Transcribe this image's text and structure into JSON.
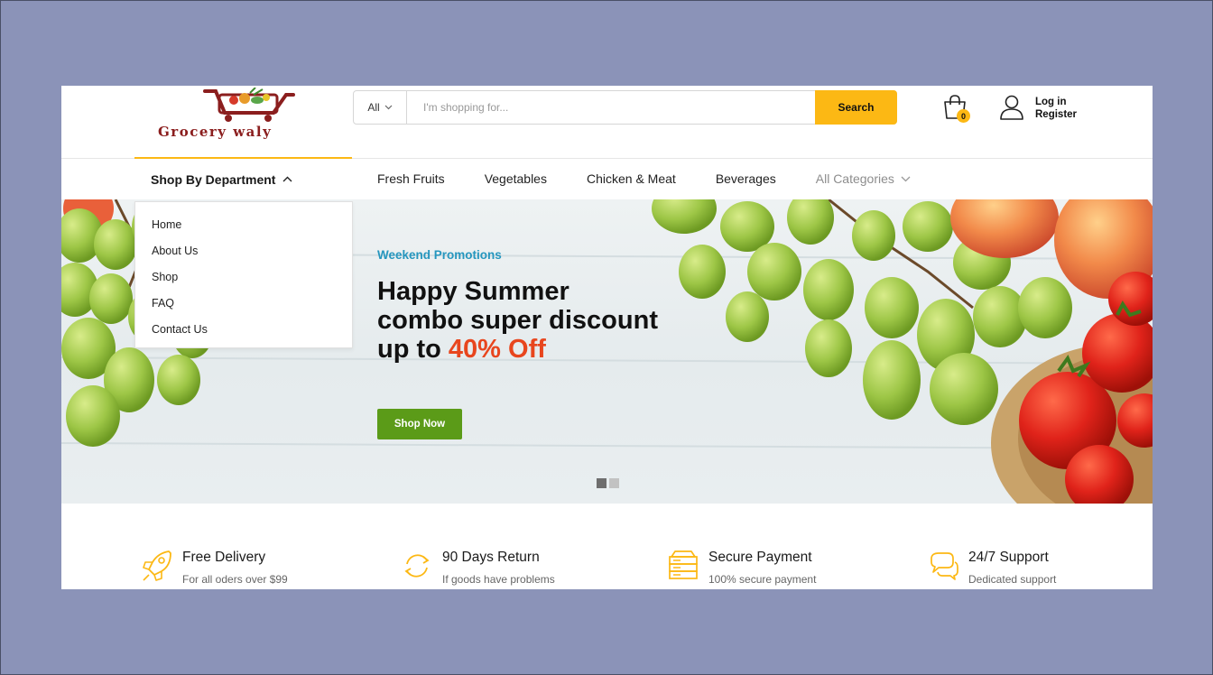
{
  "brand": {
    "name": "Grocery waly",
    "accent_color": "#fcb814",
    "logo_color": "#8b1e1e"
  },
  "search": {
    "category": "All",
    "placeholder": "I'm shopping for...",
    "button": "Search"
  },
  "cart": {
    "count": "0",
    "icon": "shopping-bag-icon"
  },
  "account": {
    "login": "Log in",
    "register": "Register",
    "icon": "user-icon"
  },
  "nav": {
    "department": "Shop By Department",
    "links": [
      "Fresh Fruits",
      "Vegetables",
      "Chicken & Meat",
      "Beverages"
    ],
    "all_categories": "All Categories"
  },
  "dropdown": {
    "items": [
      "Home",
      "About Us",
      "Shop",
      "FAQ",
      "Contact Us"
    ]
  },
  "hero": {
    "tag": "Weekend Promotions",
    "line1": "Happy Summer",
    "line2": "combo super discount",
    "line3_prefix": "up to",
    "line3_accent": "40% Off",
    "cta": "Shop Now",
    "cta_color": "#5b9b18",
    "tag_color": "#2596be",
    "accent_color": "#e8461e",
    "slides": 2,
    "active_slide": 1
  },
  "features": [
    {
      "title": "Free Delivery",
      "subtitle": "For all oders over $99",
      "icon": "rocket-icon"
    },
    {
      "title": "90 Days Return",
      "subtitle": "If goods have problems",
      "icon": "return-arrows-icon"
    },
    {
      "title": "Secure Payment",
      "subtitle": "100% secure payment",
      "icon": "server-payment-icon"
    },
    {
      "title": "24/7 Support",
      "subtitle": "Dedicated support",
      "icon": "chat-bubbles-icon"
    }
  ]
}
